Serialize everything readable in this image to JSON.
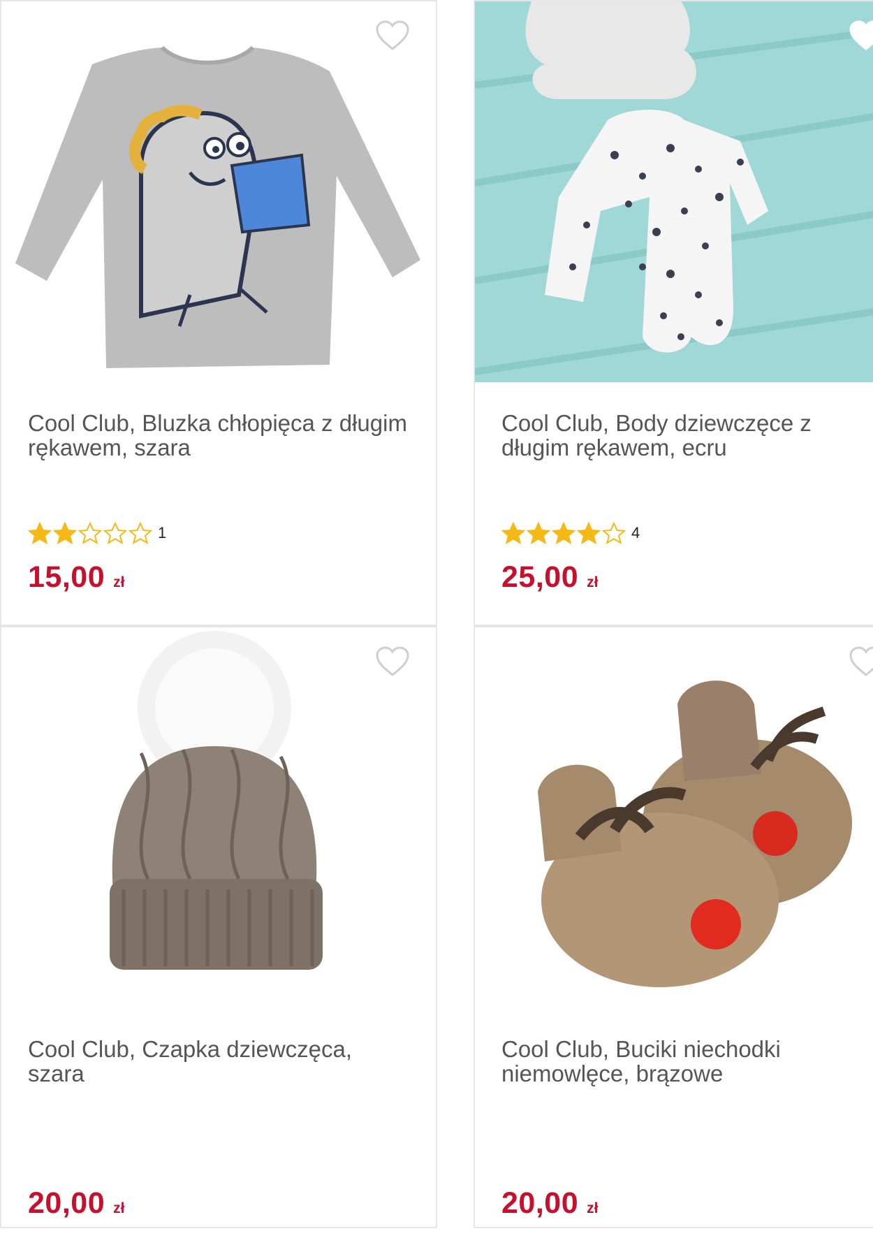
{
  "colors": {
    "price": "#c8102e",
    "star": "#f5b915",
    "border": "#e6e6e6"
  },
  "products": [
    {
      "title": "Cool Club, Bluzka chłopięca z długim rękawem, szara",
      "rating": 2,
      "rating_count": "1",
      "price": "15,00",
      "currency": "zł",
      "image": "grey-long-sleeve-shirt-with-dinosaur-reading-book"
    },
    {
      "title": "Cool Club, Body dziewczęce z długim rękawem, ecru",
      "rating": 4,
      "rating_count": "4",
      "price": "25,00",
      "currency": "zł",
      "image": "white-dotted-baby-bodysuit-on-mint-blanket"
    },
    {
      "title": "Cool Club, Czapka dziewczęca, szara",
      "price": "20,00",
      "currency": "zł",
      "image": "grey-knit-beanie-with-white-pompom"
    },
    {
      "title": "Cool Club, Buciki niechodki niemowlęce, brązowe",
      "price": "20,00",
      "currency": "zł",
      "image": "brown-reindeer-baby-slippers"
    }
  ],
  "icons": {
    "favorite": "heart-outline-icon",
    "star_full": "star-filled-icon",
    "star_empty": "star-outline-icon"
  }
}
